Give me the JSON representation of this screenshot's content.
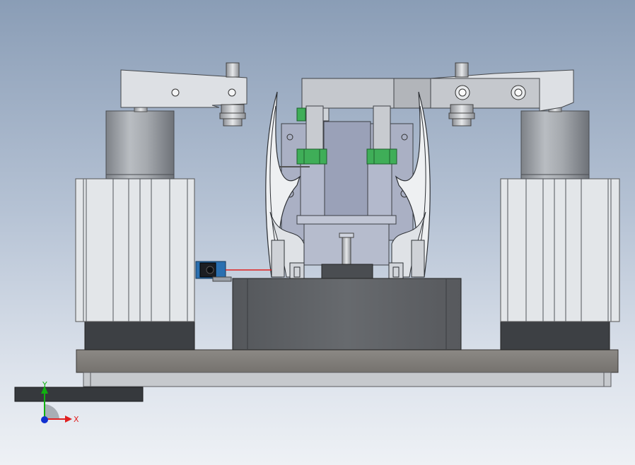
{
  "viewport": {
    "name": "cad-3d-viewport",
    "background_top": "#8a9db6",
    "background_bottom": "#eef1f5"
  },
  "triad": {
    "x_label": "X",
    "y_label": "Y",
    "x_color": "#e02020",
    "y_color": "#10b010",
    "z_color": "#1030d0"
  },
  "colors": {
    "clamp_arm": "#dcdfe4",
    "cylinder": "#9a9ea4",
    "profile_body": "#e4e7ea",
    "dark_base": "#3f4246",
    "motor_box": "#606468",
    "base_plate": "#7f7c78",
    "frame": "#a8aec2",
    "green_nut": "#3fae58",
    "sensor_blue": "#2a6fb0",
    "laser_red": "#e02020"
  }
}
